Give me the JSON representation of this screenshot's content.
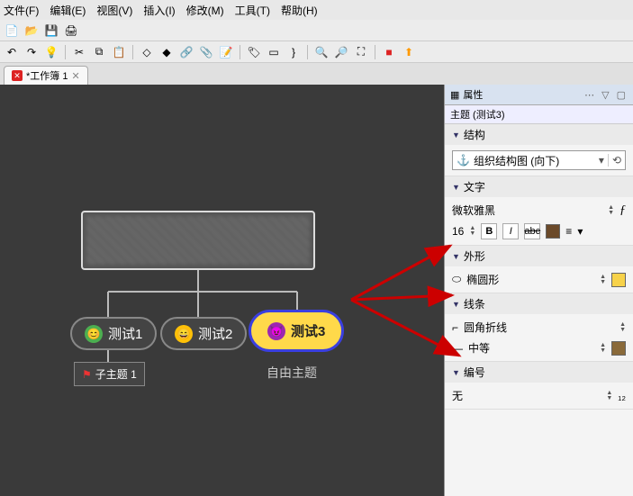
{
  "menu": {
    "file": "文件(F)",
    "edit": "编辑(E)",
    "view": "视图(V)",
    "insert": "插入(I)",
    "modify": "修改(M)",
    "tools": "工具(T)",
    "help": "帮助(H)"
  },
  "tab": {
    "title": "*工作簿 1"
  },
  "canvas": {
    "child1": "测试1",
    "child2": "测试2",
    "child3": "测试3",
    "subtopic": "子主题 1",
    "freetopic": "自由主题"
  },
  "panel": {
    "title": "属性",
    "subtitle": "主题 (测试3)",
    "sections": {
      "structure": {
        "label": "结构",
        "value": "组织结构图 (向下)"
      },
      "text": {
        "label": "文字",
        "font": "微软雅黑",
        "size": "16",
        "color": "#6b4a2a",
        "align_color": "#333"
      },
      "shape": {
        "label": "外形",
        "value": "椭圆形",
        "fill": "#f7d24a"
      },
      "line": {
        "label": "线条",
        "style": "圆角折线",
        "weight": "中等",
        "color": "#8a6a3a"
      },
      "number": {
        "label": "编号",
        "value": "无"
      }
    }
  }
}
